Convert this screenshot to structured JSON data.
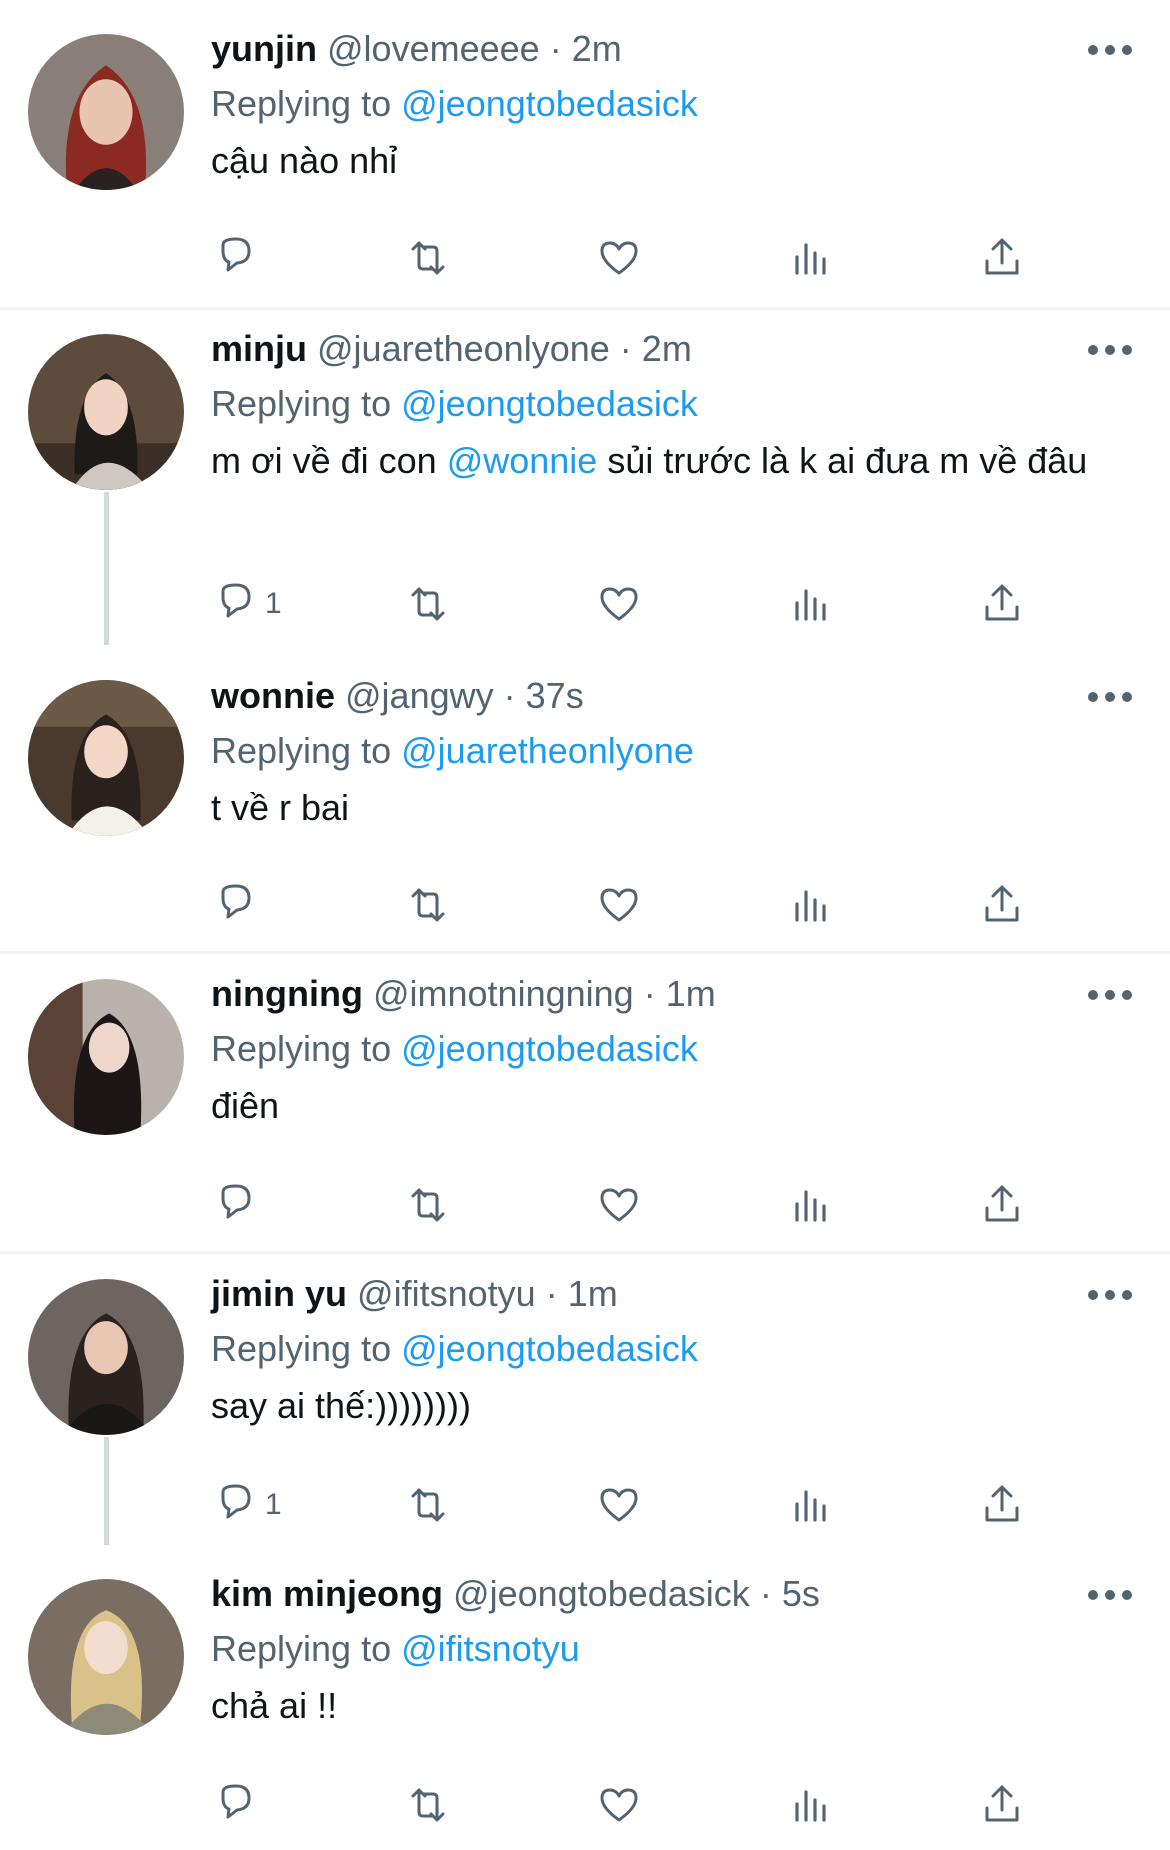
{
  "tweets": [
    {
      "name": "yunjin",
      "handle": "@lovemeeee",
      "time": "2m",
      "replying_label": "Replying to",
      "replying_to": "@jeongtobedasick",
      "body": [
        {
          "text": "cậu nào nhỉ"
        }
      ],
      "reply_count": ""
    },
    {
      "name": "minju",
      "handle": "@juaretheonlyone",
      "time": "2m",
      "replying_label": "Replying to",
      "replying_to": "@jeongtobedasick",
      "body": [
        {
          "text": "m ơi về đi con "
        },
        {
          "text": "@wonnie",
          "mention": true
        },
        {
          "text": " sủi trước là k ai đưa m về đâu"
        }
      ],
      "reply_count": "1"
    },
    {
      "name": "wonnie",
      "handle": "@jangwy",
      "time": "37s",
      "replying_label": "Replying to",
      "replying_to": "@juaretheonlyone",
      "body": [
        {
          "text": "t về r bai"
        }
      ],
      "reply_count": ""
    },
    {
      "name": "ningning",
      "handle": "@imnotningning",
      "time": "1m",
      "replying_label": "Replying to",
      "replying_to": "@jeongtobedasick",
      "body": [
        {
          "text": "điên"
        }
      ],
      "reply_count": ""
    },
    {
      "name": "jimin yu",
      "handle": "@ifitsnotyu",
      "time": "1m",
      "replying_label": "Replying to",
      "replying_to": "@jeongtobedasick",
      "body": [
        {
          "text": "say ai thế:))))))))"
        }
      ],
      "reply_count": "1"
    },
    {
      "name": "kim minjeong",
      "handle": "@jeongtobedasick",
      "time": "5s",
      "replying_label": "Replying to",
      "replying_to": "@ifitsnotyu",
      "body": [
        {
          "text": "chả ai !!"
        }
      ],
      "reply_count": ""
    }
  ],
  "separator": "·",
  "icons": [
    "reply-icon",
    "retweet-icon",
    "like-icon",
    "views-icon",
    "share-icon",
    "more-icon"
  ],
  "colors": {
    "link": "#1d9bf0",
    "secondary_text": "#536471",
    "primary_text": "#0f1419",
    "thread_line": "#cfd9de",
    "divider": "#eff3f4"
  }
}
